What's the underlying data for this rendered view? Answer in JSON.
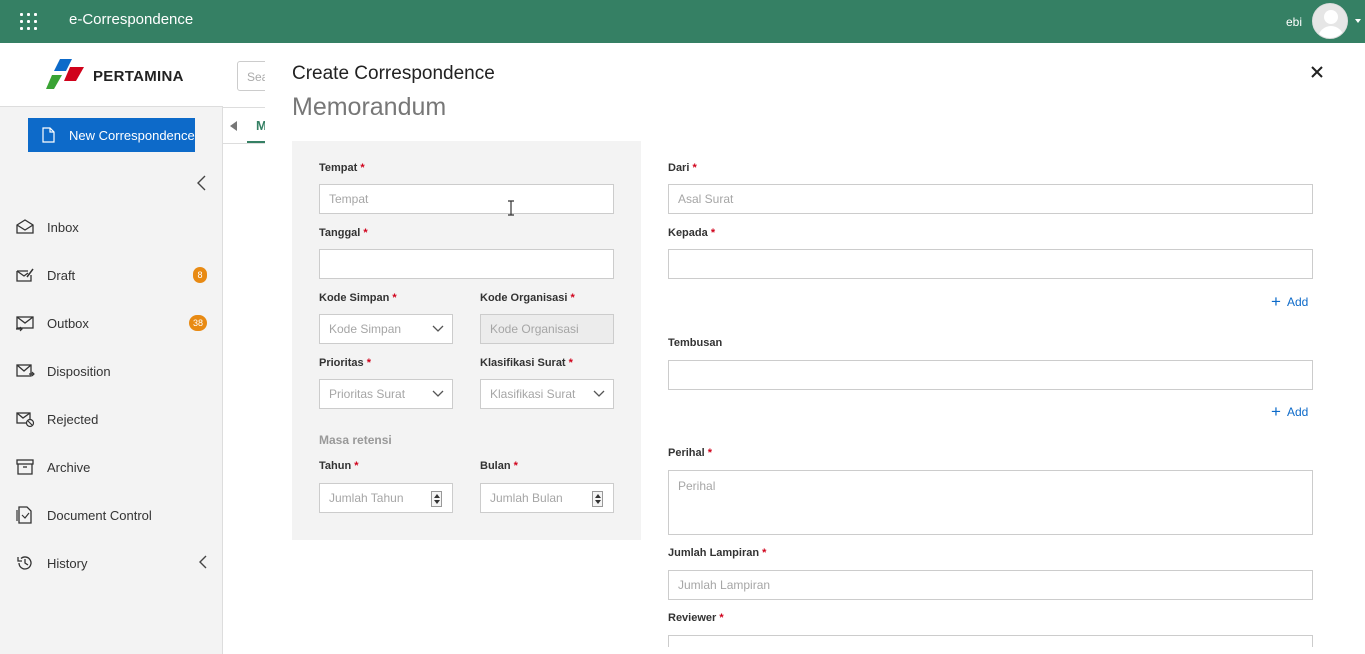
{
  "app": {
    "title": "e-Correspondence",
    "user": "ebi"
  },
  "sidebar": {
    "logo_text": "PERTAMINA",
    "new_button": "New Correspondence",
    "items": [
      {
        "label": "Inbox",
        "icon": "inbox-icon"
      },
      {
        "label": "Draft",
        "icon": "draft-icon",
        "badge": "8"
      },
      {
        "label": "Outbox",
        "icon": "outbox-icon",
        "badge": "38"
      },
      {
        "label": "Disposition",
        "icon": "disposition-icon"
      },
      {
        "label": "Rejected",
        "icon": "rejected-icon"
      },
      {
        "label": "Archive",
        "icon": "archive-icon"
      },
      {
        "label": "Document Control",
        "icon": "document-control-icon"
      },
      {
        "label": "History",
        "icon": "history-icon"
      }
    ]
  },
  "background": {
    "search_placeholder": "Sea",
    "tab_label": "M"
  },
  "modal": {
    "title": "Create Correspondence",
    "subtitle": "Memorandum",
    "left": {
      "tempat": {
        "label": "Tempat",
        "placeholder": "Tempat"
      },
      "tanggal": {
        "label": "Tanggal",
        "value": ""
      },
      "kode_simpan": {
        "label": "Kode Simpan",
        "placeholder": "Kode Simpan"
      },
      "kode_organisasi": {
        "label": "Kode Organisasi",
        "placeholder": "Kode Organisasi"
      },
      "prioritas": {
        "label": "Prioritas",
        "placeholder": "Prioritas Surat"
      },
      "klasifikasi": {
        "label": "Klasifikasi Surat",
        "placeholder": "Klasifikasi Surat"
      },
      "masa_retensi": "Masa retensi",
      "tahun": {
        "label": "Tahun",
        "placeholder": "Jumlah Tahun"
      },
      "bulan": {
        "label": "Bulan",
        "placeholder": "Jumlah Bulan"
      }
    },
    "right": {
      "dari": {
        "label": "Dari",
        "placeholder": "Asal Surat"
      },
      "kepada": {
        "label": "Kepada",
        "value": ""
      },
      "tembusan": {
        "label": "Tembusan",
        "value": ""
      },
      "add_label": "Add",
      "perihal": {
        "label": "Perihal",
        "placeholder": "Perihal"
      },
      "jumlah_lampiran": {
        "label": "Jumlah Lampiran",
        "placeholder": "Jumlah Lampiran"
      },
      "reviewer": {
        "label": "Reviewer"
      }
    },
    "required_mark": "*"
  },
  "colors": {
    "topbar": "#358064",
    "primary": "#0d6ac9",
    "badge": "#e88a13",
    "required": "#d0021b"
  }
}
